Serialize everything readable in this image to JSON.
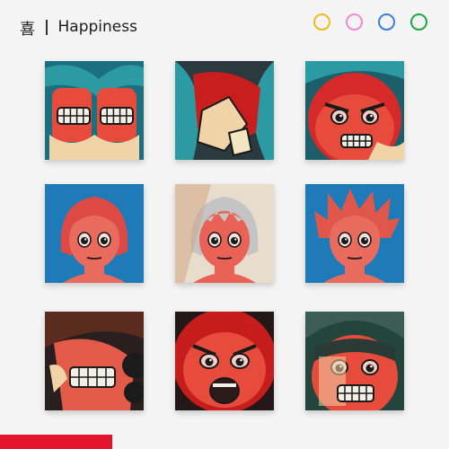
{
  "header": {
    "glyph": "喜",
    "title": "Happiness"
  },
  "palette": [
    {
      "name": "yellow-swatch",
      "color": "#f2b820"
    },
    {
      "name": "pink-swatch",
      "color": "#ee8ccf"
    },
    {
      "name": "blue-swatch",
      "color": "#3a7fe0"
    },
    {
      "name": "green-swatch",
      "color": "#1ba845"
    }
  ],
  "accent": "#e4132e",
  "tiles": [
    {
      "name": "tile-fists",
      "variant": "fists",
      "bg": "#1b6f7e",
      "skin": "#e74b3c",
      "hair": "#d92a2a",
      "accent": "#2c9aa3"
    },
    {
      "name": "tile-fist-raise",
      "variant": "raise",
      "bg": "#2a3a3f",
      "skin": "#e74b3c",
      "hair": "#c91e1e",
      "accent": "#2c9aa3"
    },
    {
      "name": "tile-angry-closeup",
      "variant": "angry",
      "bg": "#1c5f6b",
      "skin": "#e74b3c",
      "hair": "#d62a2a",
      "accent": "#2c9aa3"
    },
    {
      "name": "tile-portrait-short-hair",
      "variant": "face-bob",
      "bg": "#1f7bb8",
      "skin": "#e86b5e",
      "hair": "#dd4a46",
      "accent": "#1f7bb8"
    },
    {
      "name": "tile-portrait-white-hair",
      "variant": "face-white",
      "bg": "#e8dccd",
      "skin": "#ea6155",
      "hair": "#c4c4c4",
      "accent": "#d64040"
    },
    {
      "name": "tile-portrait-spiky-hair",
      "variant": "face-spiky",
      "bg": "#1f7bb8",
      "skin": "#e86b5e",
      "hair": "#e0574a",
      "accent": "#1f7bb8"
    },
    {
      "name": "tile-teeth-closeup",
      "variant": "teeth",
      "bg": "#2a1f1f",
      "skin": "#e35a48",
      "hair": "#5a2b1e",
      "accent": "#1b1b1b"
    },
    {
      "name": "tile-shout",
      "variant": "shout",
      "bg": "#231817",
      "skin": "#e74b3c",
      "hair": "#c61c1c",
      "accent": "#2b1b1b"
    },
    {
      "name": "tile-grin-helmet",
      "variant": "grin",
      "bg": "#24453c",
      "skin": "#e74b3c",
      "hair": "#2a3b36",
      "accent": "#3d5c55"
    }
  ]
}
